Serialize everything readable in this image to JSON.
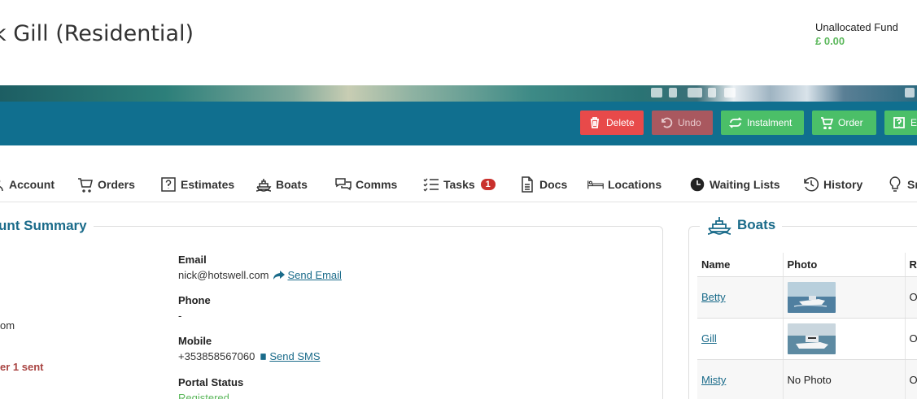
{
  "header": {
    "title": "k Gill (Residential)",
    "funds_label": "Unallocated Fund",
    "funds_value": "£ 0.00"
  },
  "toolbar": {
    "delete": "Delete",
    "undo": "Undo",
    "instalment": "Instalment",
    "order": "Order",
    "estimate": "E"
  },
  "tabs": [
    {
      "label": "Account",
      "icon": "user-icon"
    },
    {
      "label": "Orders",
      "icon": "cart-icon"
    },
    {
      "label": "Estimates",
      "icon": "question-square-icon"
    },
    {
      "label": "Boats",
      "icon": "boat-icon"
    },
    {
      "label": "Comms",
      "icon": "chat-icon"
    },
    {
      "label": "Tasks",
      "icon": "checklist-icon",
      "badge": "1"
    },
    {
      "label": "Docs",
      "icon": "document-icon"
    },
    {
      "label": "Locations",
      "icon": "bed-icon"
    },
    {
      "label": "Waiting Lists",
      "icon": "clock-icon"
    },
    {
      "label": "History",
      "icon": "history-icon"
    },
    {
      "label": "Sm",
      "icon": "lightbulb-icon"
    }
  ],
  "summary": {
    "legend": "unt Summary",
    "left_fragment_1": "om",
    "left_fragment_2": "er 1 sent",
    "email_label": "Email",
    "email_value": "nick@hotswell.com",
    "send_email": "Send Email",
    "phone_label": "Phone",
    "phone_value": "-",
    "mobile_label": "Mobile",
    "mobile_value": "+353858567060",
    "send_sms": "Send SMS",
    "portal_label": "Portal Status",
    "portal_value": "Registered"
  },
  "boats": {
    "legend": "Boats",
    "columns": [
      "Name",
      "Photo",
      "R"
    ],
    "rows": [
      {
        "name": "Betty",
        "photo": "thumbnail",
        "r": "O"
      },
      {
        "name": "Gill",
        "photo": "thumbnail",
        "r": "O"
      },
      {
        "name": "Misty",
        "photo": "No Photo",
        "r": "O"
      }
    ]
  },
  "colors": {
    "toolbar": "#106f8f",
    "delete": "#e84a4a",
    "undo": "#a9585f",
    "green": "#4bbf68",
    "link": "#1a6b8a"
  }
}
